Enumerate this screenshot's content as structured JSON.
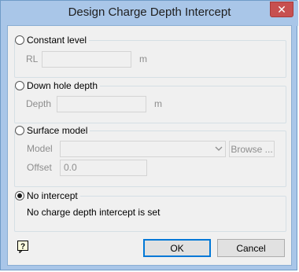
{
  "window": {
    "title": "Design Charge Depth Intercept",
    "close_glyph": "✕"
  },
  "groups": {
    "constant": {
      "radio_label": "Constant level",
      "selected": false,
      "field_label": "RL",
      "value": "",
      "unit": "m"
    },
    "downhole": {
      "radio_label": "Down hole depth",
      "selected": false,
      "field_label": "Depth",
      "value": "",
      "unit": "m"
    },
    "surface": {
      "radio_label": "Surface model",
      "selected": false,
      "model_label": "Model",
      "model_value": "",
      "browse_label": "Browse ...",
      "offset_label": "Offset",
      "offset_value": "0.0"
    },
    "nointercept": {
      "radio_label": "No intercept",
      "selected": true,
      "message": "No charge depth intercept is set"
    }
  },
  "footer": {
    "help_icon": "help-icon",
    "ok_label": "OK",
    "cancel_label": "Cancel"
  },
  "colors": {
    "titlebar": "#a9c6e8",
    "close": "#c75050",
    "panel": "#f0f0f0",
    "disabled_text": "#8d8d8d",
    "focus": "#0078d7"
  }
}
